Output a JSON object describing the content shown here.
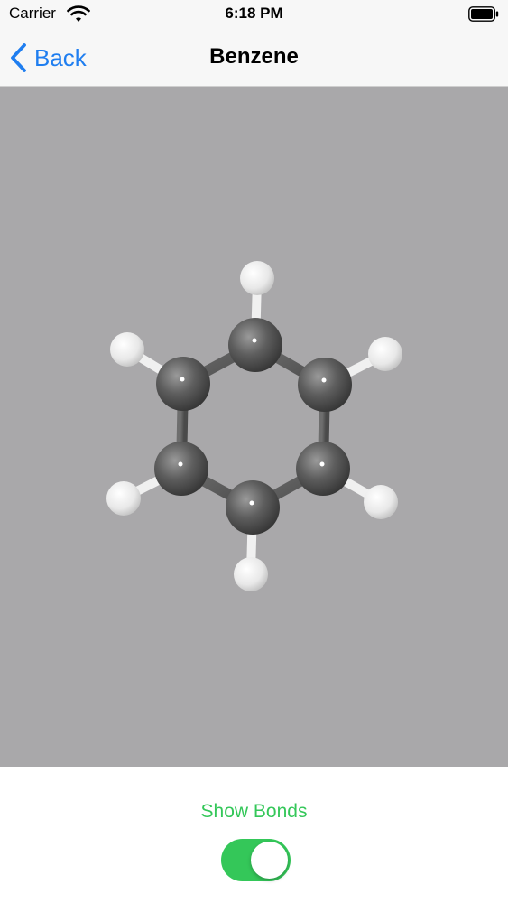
{
  "status_bar": {
    "carrier": "Carrier",
    "time": "6:18 PM"
  },
  "nav": {
    "back_label": "Back",
    "title": "Benzene"
  },
  "controls": {
    "show_bonds_label": "Show Bonds",
    "show_bonds_on": true
  },
  "colors": {
    "accent_blue": "#1f7ef0",
    "toggle_green": "#34c759",
    "scene_background": "#a9a8aa",
    "carbon_atom": "#5a5a5a",
    "hydrogen_atom": "#f2f2f2"
  },
  "molecule": {
    "name": "Benzene",
    "atoms": [
      "C",
      "C",
      "C",
      "C",
      "C",
      "C",
      "H",
      "H",
      "H",
      "H",
      "H",
      "H"
    ]
  }
}
